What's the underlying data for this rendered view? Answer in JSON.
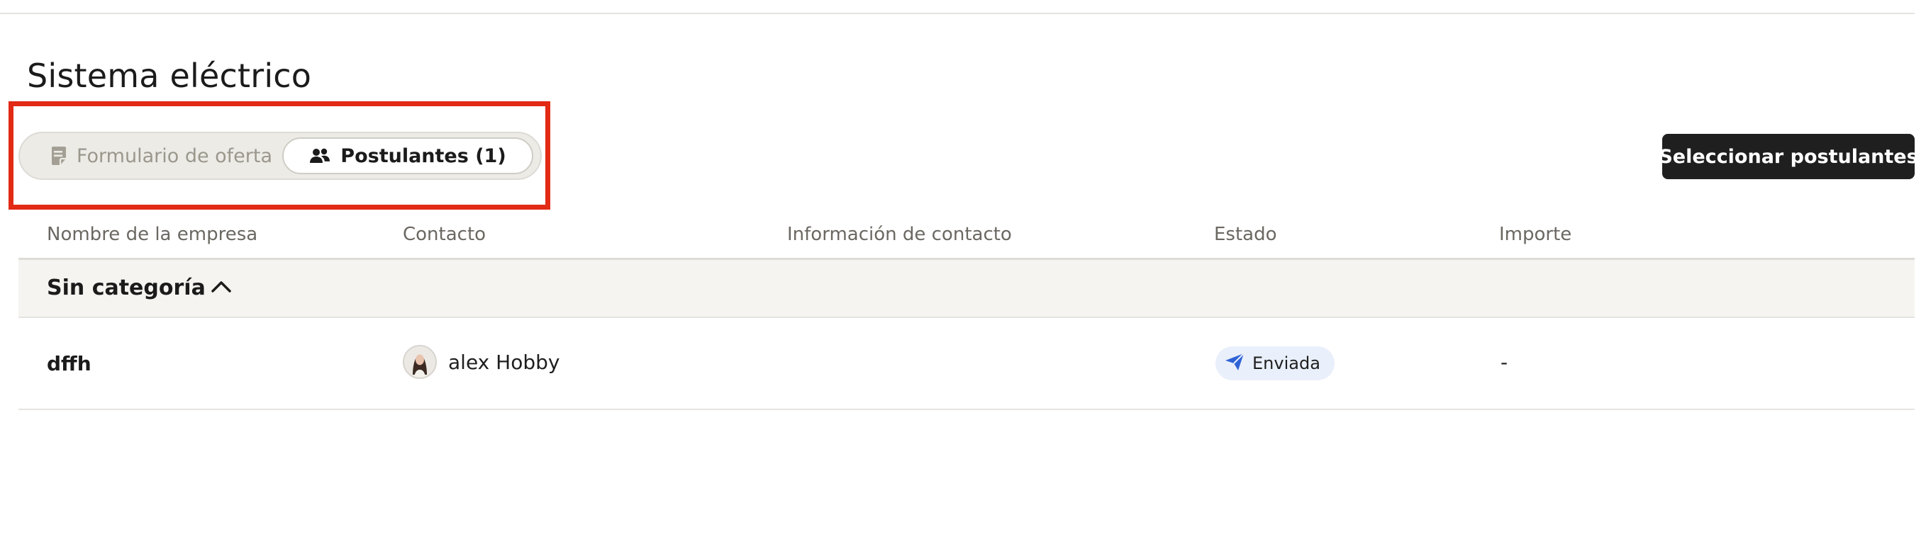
{
  "section": {
    "title": "Sistema eléctrico"
  },
  "tabs": [
    {
      "label": "Formulario de oferta",
      "icon": "form-icon",
      "active": false
    },
    {
      "label": "Postulantes (1)",
      "icon": "people-icon",
      "active": true
    }
  ],
  "actions": {
    "select_label": "Seleccionar postulantes"
  },
  "table": {
    "columns": [
      "Nombre de la empresa",
      "Contacto",
      "Información de contacto",
      "Estado",
      "Importe"
    ],
    "groups": [
      {
        "label": "Sin categoría",
        "expanded": true,
        "rows": [
          {
            "company": "dffh",
            "contact": "alex Hobby",
            "contact_info": "",
            "status": "Enviada",
            "amount": "-"
          }
        ]
      }
    ]
  },
  "colors": {
    "highlight": "#e22a14",
    "primary_button": "#1f1f1f",
    "status_icon": "#2f63d6",
    "status_badge_bg": "#eaf0fb"
  }
}
